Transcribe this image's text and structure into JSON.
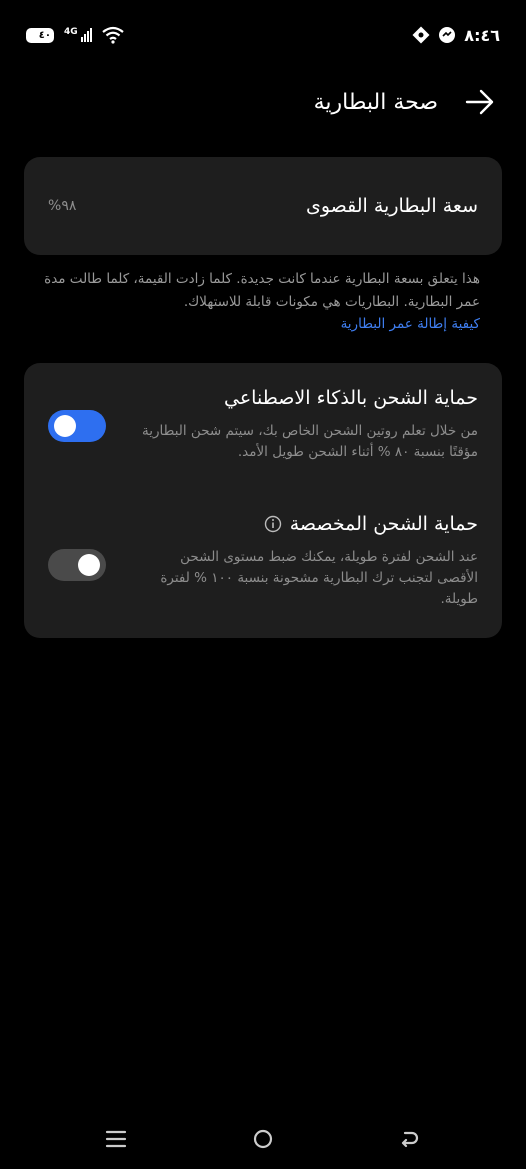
{
  "status_bar": {
    "battery_level": "٤٠",
    "network_type": "4G",
    "time": "٨:٤٦"
  },
  "header": {
    "title": "صحة البطارية"
  },
  "capacity": {
    "label": "سعة البطارية القصوى",
    "value": "%٩٨"
  },
  "info": {
    "text": "هذا يتعلق بسعة البطارية عندما كانت جديدة. كلما زادت القيمة، كلما طالت مدة عمر البطارية. البطاريات هي مكونات قابلة للاستهلاك.",
    "link": "كيفية إطالة عمر البطارية"
  },
  "protection": {
    "smart": {
      "title": "حماية الشحن بالذكاء الاصطناعي",
      "description": "من خلال تعلم روتين الشحن الخاص بك، سيتم شحن البطارية مؤقتًا بنسبة ٨٠ % أثناء الشحن طويل الأمد.",
      "enabled": true
    },
    "custom": {
      "title": "حماية الشحن المخصصة",
      "description": "عند الشحن لفترة طويلة، يمكنك ضبط مستوى الشحن الأقصى لتجنب ترك البطارية مشحونة بنسبة ١٠٠ % لفترة طويلة.",
      "enabled": true
    }
  },
  "colors": {
    "background": "#000000",
    "card": "#1e1e1e",
    "accent": "#2e6ff0",
    "link": "#3f7ef0",
    "secondary_text": "#8d8d8d"
  }
}
